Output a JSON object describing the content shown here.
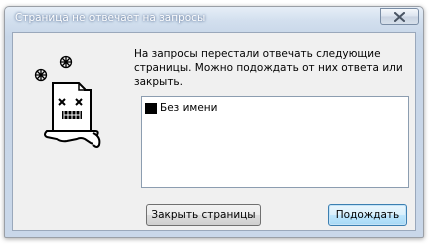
{
  "dialog": {
    "title": "Страница не отвечает на запросы",
    "message": "На запросы перестали отвечать следующие страницы. Можно подождать от них ответа или закрыть.",
    "pages": [
      {
        "label": "Без имени"
      }
    ],
    "buttons": {
      "close_pages": "Закрыть страницы",
      "wait": "Подождать"
    },
    "icons": {
      "close": "close-icon",
      "illustration": "frozen-page-icon",
      "snowflake": "snowflake-icon",
      "page": "page-icon"
    }
  }
}
